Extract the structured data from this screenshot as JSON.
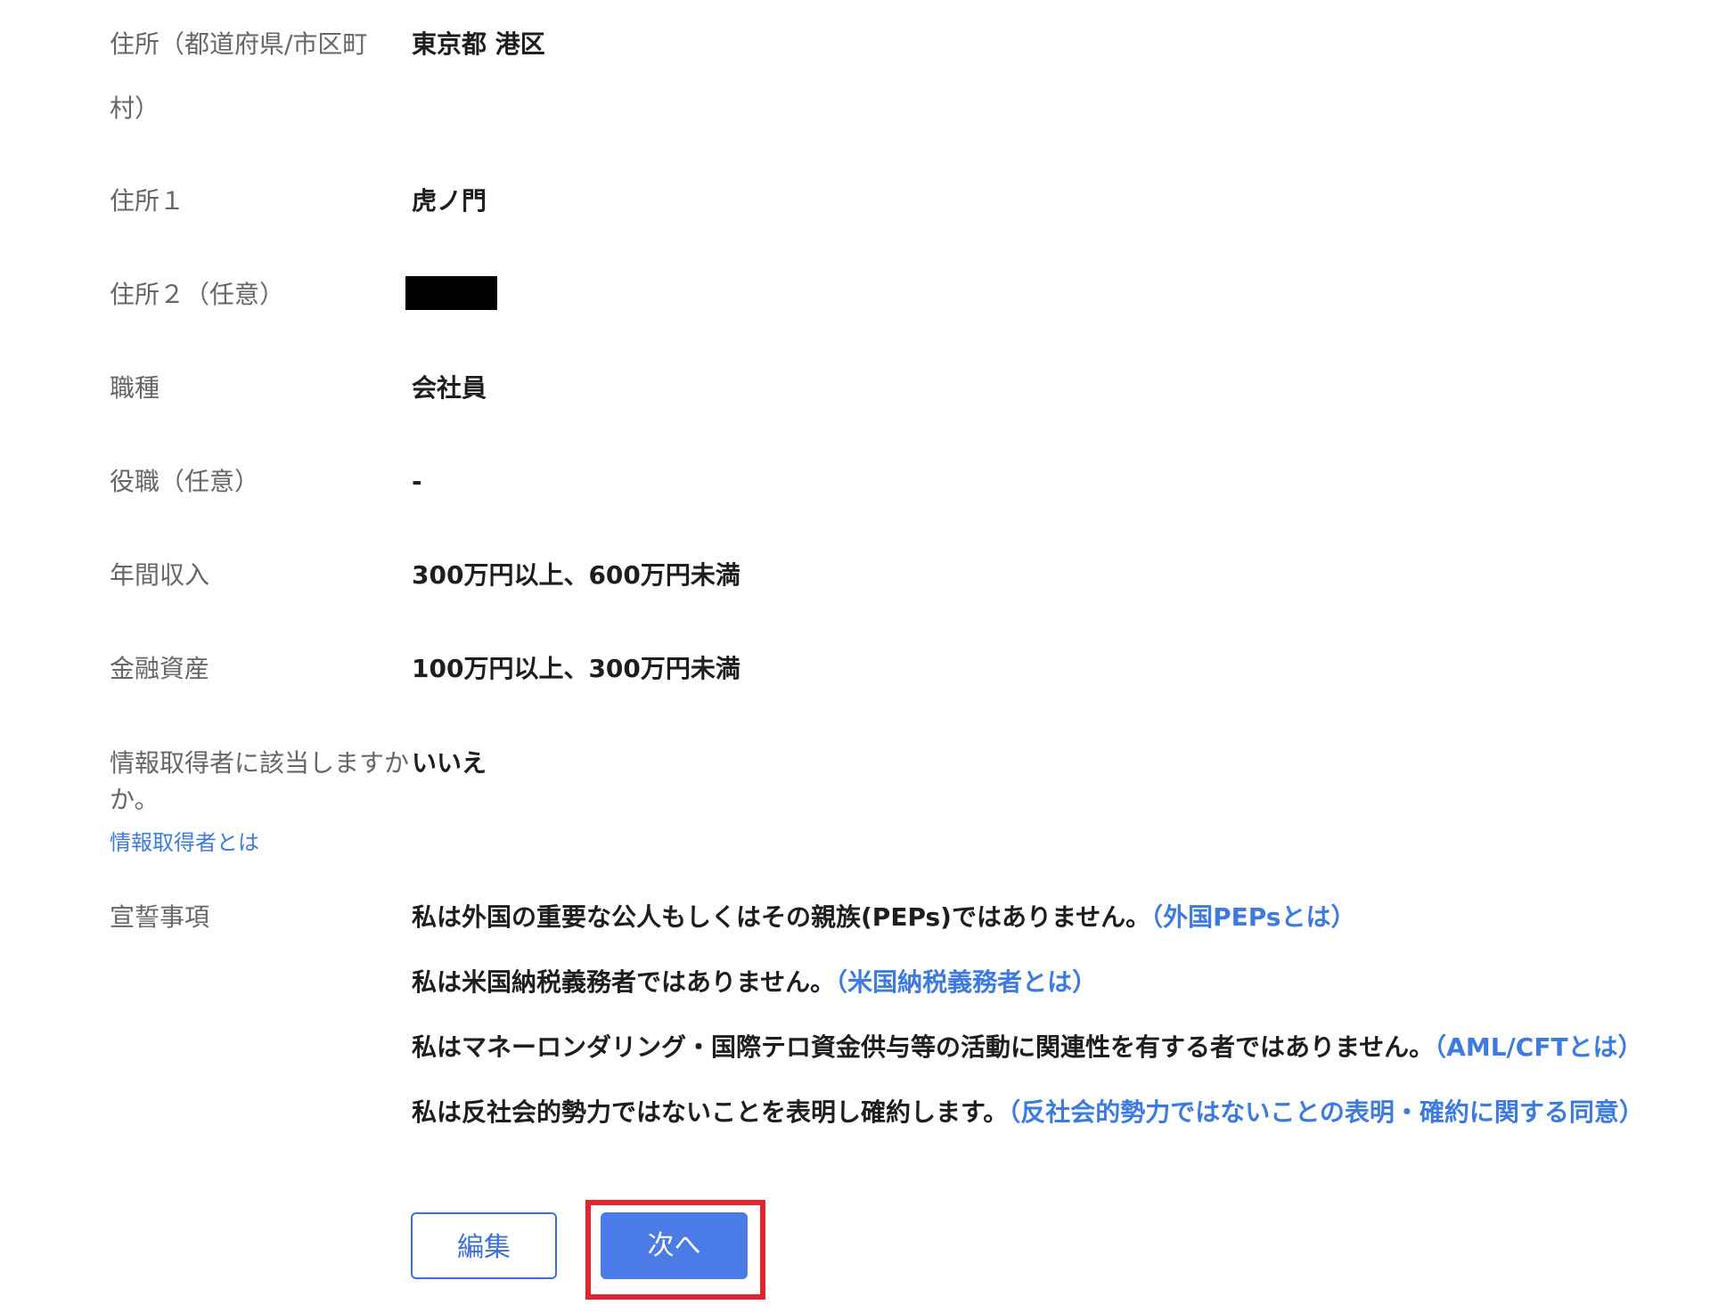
{
  "rows": {
    "address_pref": {
      "label_line1": "住所（都道府県/市区町",
      "label_line2": "村）",
      "value": "東京都 港区"
    },
    "address1": {
      "label": "住所１",
      "value": "虎ノ門"
    },
    "address2": {
      "label": "住所２（任意）"
    },
    "occupation": {
      "label": "職種",
      "value": "会社員"
    },
    "position": {
      "label": "役職（任意）",
      "value": "-"
    },
    "income": {
      "label": "年間収入",
      "value": "300万円以上、600万円未満"
    },
    "assets": {
      "label": "金融資産",
      "value": "100万円以上、300万円未満"
    },
    "info_acquirer": {
      "label_line1": "情報取得者に該当しますか",
      "label_line2": "か。",
      "link": "情報取得者とは",
      "value": "いいえ"
    },
    "declarations": {
      "label": "宣誓事項",
      "items": [
        {
          "text": "私は外国の重要な公人もしくはその親族(PEPs)ではありません。",
          "link": "（外国PEPsとは）"
        },
        {
          "text": "私は米国納税義務者ではありません。",
          "link": "（米国納税義務者とは）"
        },
        {
          "text": "私はマネーロンダリング・国際テロ資金供与等の活動に関連性を有する者ではありません。",
          "link": "（AML/CFTとは）"
        },
        {
          "text": "私は反社会的勢力ではないことを表明し確約します。",
          "link": "（反社会的勢力ではないことの表明・確約に関する同意）"
        }
      ]
    }
  },
  "buttons": {
    "edit": "編集",
    "next": "次へ"
  },
  "colors": {
    "accent": "#4a7be6",
    "link": "#3d7be0",
    "highlight": "#e5232e"
  }
}
